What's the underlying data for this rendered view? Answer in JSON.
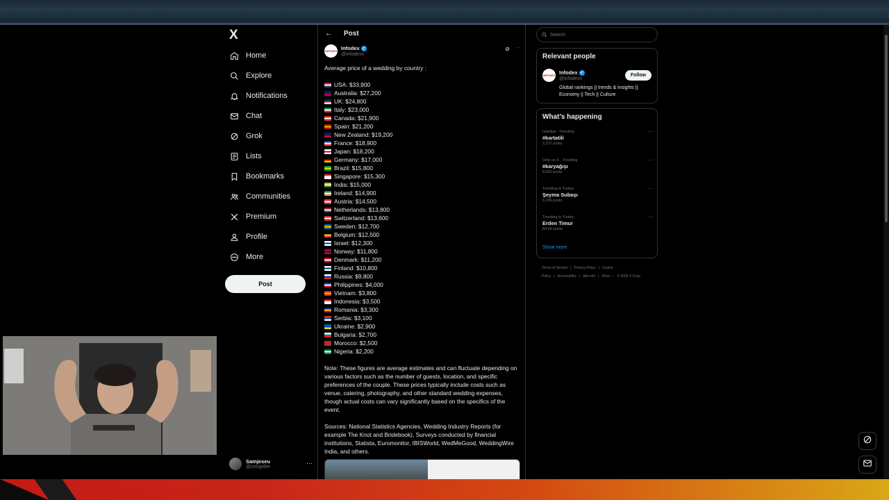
{
  "nav": {
    "logo": "X",
    "items": [
      {
        "label": "Home",
        "icon": "home-icon"
      },
      {
        "label": "Explore",
        "icon": "search-icon"
      },
      {
        "label": "Notifications",
        "icon": "bell-icon"
      },
      {
        "label": "Chat",
        "icon": "mail-icon"
      },
      {
        "label": "Grok",
        "icon": "grok-icon"
      },
      {
        "label": "Lists",
        "icon": "list-icon"
      },
      {
        "label": "Bookmarks",
        "icon": "bookmark-icon"
      },
      {
        "label": "Communities",
        "icon": "communities-icon"
      },
      {
        "label": "Premium",
        "icon": "x-icon"
      },
      {
        "label": "Profile",
        "icon": "profile-icon"
      },
      {
        "label": "More",
        "icon": "more-circle-icon"
      }
    ],
    "post_button": "Post",
    "account": {
      "name": "Samjeseu",
      "handle": "@congeller"
    }
  },
  "header": {
    "title": "Post"
  },
  "post": {
    "author": "Infodex",
    "handle": "@infodexx",
    "avatar_text": "INFODEX",
    "intro": "Average price of a wedding by country :",
    "rows": [
      {
        "text": "USA: $33,900",
        "flag": [
          "#b22234",
          "#ffffff",
          "#3c3b6e"
        ]
      },
      {
        "text": "Australia: $27,200",
        "flag": [
          "#012169",
          "#012169",
          "#e4002b"
        ]
      },
      {
        "text": "UK: $24,800",
        "flag": [
          "#012169",
          "#c8102e",
          "#ffffff"
        ]
      },
      {
        "text": "Italy: $23,000",
        "flag": [
          "#009246",
          "#ffffff",
          "#ce2b37"
        ]
      },
      {
        "text": "Canada: $21,900",
        "flag": [
          "#d52b1e",
          "#ffffff",
          "#d52b1e"
        ]
      },
      {
        "text": "Spain: $21,200",
        "flag": [
          "#aa151b",
          "#f1bf00",
          "#aa151b"
        ]
      },
      {
        "text": "New Zealand: $19,200",
        "flag": [
          "#012169",
          "#012169",
          "#cc142b"
        ]
      },
      {
        "text": "France: $18,900",
        "flag": [
          "#0055a4",
          "#ffffff",
          "#ef4135"
        ]
      },
      {
        "text": "Japan: $18,200",
        "flag": [
          "#ffffff",
          "#bc002d",
          "#ffffff"
        ]
      },
      {
        "text": "Germany: $17,000",
        "flag": [
          "#000000",
          "#dd0000",
          "#ffce00"
        ]
      },
      {
        "text": "Brazil: $15,800",
        "flag": [
          "#009c3b",
          "#ffdf00",
          "#009c3b"
        ]
      },
      {
        "text": "Singapore: $15,300",
        "flag": [
          "#ef3340",
          "#ffffff",
          "#ffffff"
        ]
      },
      {
        "text": "India: $15,000",
        "flag": [
          "#ff9933",
          "#ffffff",
          "#138808"
        ]
      },
      {
        "text": "Ireland: $14,900",
        "flag": [
          "#169b62",
          "#ffffff",
          "#ff883e"
        ]
      },
      {
        "text": "Austria: $14,500",
        "flag": [
          "#ed2939",
          "#ffffff",
          "#ed2939"
        ]
      },
      {
        "text": "Netherlands: $13,800",
        "flag": [
          "#ae1c28",
          "#ffffff",
          "#21468b"
        ]
      },
      {
        "text": "Switzerland: $13,600",
        "flag": [
          "#d52b1e",
          "#ffffff",
          "#d52b1e"
        ]
      },
      {
        "text": "Sweden: $12,700",
        "flag": [
          "#006aa7",
          "#fecc00",
          "#006aa7"
        ]
      },
      {
        "text": "Belgium: $12,500",
        "flag": [
          "#000000",
          "#fdda24",
          "#ef3340"
        ]
      },
      {
        "text": "Israel: $12,300",
        "flag": [
          "#ffffff",
          "#0038b8",
          "#ffffff"
        ]
      },
      {
        "text": "Norway: $11,800",
        "flag": [
          "#ba0c2f",
          "#00205b",
          "#ba0c2f"
        ]
      },
      {
        "text": "Denmark: $11,200",
        "flag": [
          "#c8102e",
          "#ffffff",
          "#c8102e"
        ]
      },
      {
        "text": "Finland: $10,800",
        "flag": [
          "#ffffff",
          "#002f6c",
          "#ffffff"
        ]
      },
      {
        "text": "Russia: $9,800",
        "flag": [
          "#ffffff",
          "#0039a6",
          "#d52b1e"
        ]
      },
      {
        "text": "Philippines: $4,000",
        "flag": [
          "#0038a8",
          "#ffffff",
          "#ce1126"
        ]
      },
      {
        "text": "Vietnam: $3,800",
        "flag": [
          "#da251d",
          "#ffcd00",
          "#da251d"
        ]
      },
      {
        "text": "Indonesia: $3,500",
        "flag": [
          "#ff0000",
          "#ffffff",
          "#ffffff"
        ]
      },
      {
        "text": "Romania: $3,300",
        "flag": [
          "#002b7f",
          "#fcd116",
          "#ce1126"
        ]
      },
      {
        "text": "Serbia: $3,100",
        "flag": [
          "#c6363c",
          "#0c4076",
          "#ffffff"
        ]
      },
      {
        "text": "Ukraine: $2,900",
        "flag": [
          "#0057b7",
          "#0057b7",
          "#ffd700"
        ]
      },
      {
        "text": "Bulgaria: $2,700",
        "flag": [
          "#ffffff",
          "#00966e",
          "#d62612"
        ]
      },
      {
        "text": "Morocco: $2,500",
        "flag": [
          "#c1272d",
          "#c1272d",
          "#c1272d"
        ]
      },
      {
        "text": "Nigeria: $2,200",
        "flag": [
          "#008751",
          "#ffffff",
          "#008751"
        ]
      }
    ],
    "note": "Note: These figures are average estimates and can fluctuate depending on various factors such as the number of guests, location, and specific preferences of the couple. These prices typically include costs such as venue, catering, photography, and other standard wedding expenses, though actual costs can vary significantly based on the specifics of the event.",
    "sources": "Sources: National Statistics Agencies, Wedding Industry Reports (for example The Knot and Bridebook), Surveys conducted by financial institutions, Statista, Euromonitor, IBISWorld, WedMeGood, WeddingWire India, and others."
  },
  "search": {
    "placeholder": "Search"
  },
  "relevant": {
    "title": "Relevant people",
    "name": "Infodex",
    "handle": "@infodexx",
    "follow": "Follow",
    "bio": "Global rankings || trends & insights || Economy || Tech || Culture"
  },
  "happening": {
    "title": "What’s happening",
    "trends": [
      {
        "context": "Istanbul · Trending",
        "name": "#kartatili",
        "count": "2,237 posts"
      },
      {
        "context": "Only on X · Trending",
        "name": "#karyağışı",
        "count": "9,830 posts"
      },
      {
        "context": "Trending in Turkey",
        "name": "Şeyma Subaşı",
        "count": "6,236 posts"
      },
      {
        "context": "Trending in Turkey",
        "name": "Erden Timur",
        "count": "84.6K posts"
      }
    ],
    "show_more": "Show more"
  },
  "footer": {
    "links": [
      "Terms of Service",
      "|",
      "Privacy Policy",
      "|",
      "Cookie Policy",
      "|",
      "Accessibility",
      "|",
      "Ads info",
      "|",
      "More ···",
      "© 2025 X Corp."
    ]
  },
  "colors": {
    "accent": "#1d9bf0",
    "background": "#000000",
    "text": "#e7e9ea",
    "muted": "#71767b",
    "border": "#2f3336"
  }
}
